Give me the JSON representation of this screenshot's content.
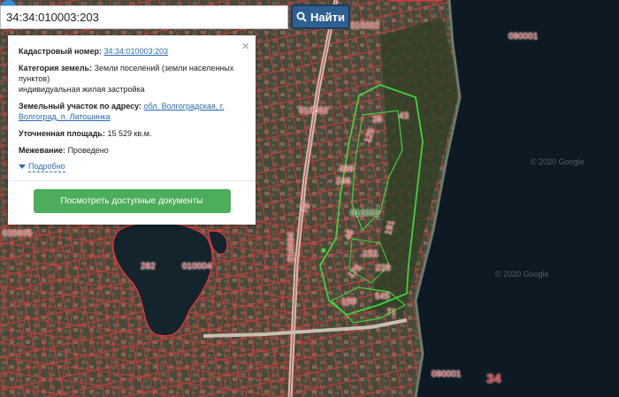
{
  "search": {
    "value": "34:34:010003:203",
    "button_label": "Найти"
  },
  "info_panel": {
    "cadastral_label": "Кадастровый номер:",
    "cadastral_value": "34:34:010003:203",
    "category_label": "Категория земель:",
    "category_value": "Земли поселений (земли населенных пунктов)",
    "category_use": "индивидуальная жилая застройка",
    "address_label": "Земельный участок по адресу:",
    "address_value": "обл. Волгоградская, г. Волгоград, п. Латошинка",
    "area_label": "Уточненная площадь:",
    "area_value": "15 529 кв.м.",
    "survey_label": "Межевание:",
    "survey_value": "Проведено",
    "more_label": "Подробно",
    "docs_button": "Посмотреть доступные документы"
  },
  "map_labels": {
    "block_010002_top": "010002",
    "block_010002_mid": "010002",
    "block_090001_top": "090001",
    "block_090001_bottom": "090001",
    "block_010005": "010005",
    "block_010004": "010004",
    "block_010004_vert": "010004",
    "block_010003": "010003",
    "parcel_282": "282",
    "parcel_125": "125",
    "parcel_25": "25",
    "parcel_43": "43",
    "parcel_439": "439",
    "parcel_246": "246",
    "parcel_46": "46",
    "parcel_191": "191",
    "parcel_175": "175",
    "parcel_152": "152",
    "parcel_229": "229",
    "parcel_150": "150",
    "parcel_545": "545",
    "parcel_71": "71",
    "parcel_78": "78",
    "region_34": "34"
  },
  "watermarks": {
    "wm1": "© 2020 Google",
    "wm2": "© 2020 Google"
  },
  "colors": {
    "water": "#0d1a24",
    "parcel_line": "#d63a3a",
    "selected_line": "#3fd23f",
    "search_button": "#2f5f8f",
    "docs_button": "#4cae5a"
  }
}
